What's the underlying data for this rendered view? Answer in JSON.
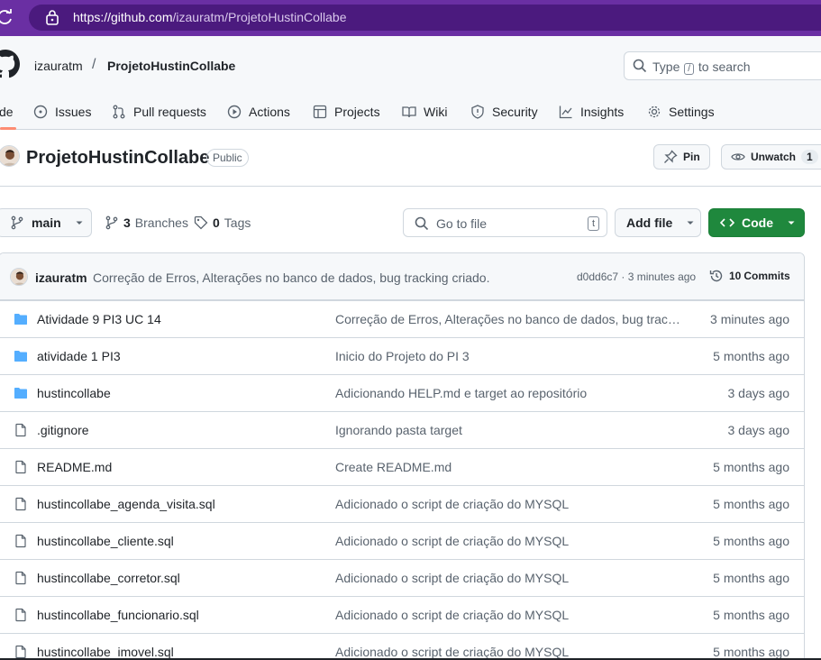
{
  "browser": {
    "url_host": "https://github.com",
    "url_path": "/izauratm/ProjetoHustinCollabe"
  },
  "header": {
    "owner": "izauratm",
    "separator": "/",
    "repo": "ProjetoHustinCollabe",
    "search_prefix": "Type",
    "search_key": "/",
    "search_suffix": "to search"
  },
  "tabs": [
    {
      "label": "de",
      "icon": "code-icon"
    },
    {
      "label": "Issues",
      "icon": "issue-icon"
    },
    {
      "label": "Pull requests",
      "icon": "pull-request-icon"
    },
    {
      "label": "Actions",
      "icon": "play-icon"
    },
    {
      "label": "Projects",
      "icon": "table-icon"
    },
    {
      "label": "Wiki",
      "icon": "book-icon"
    },
    {
      "label": "Security",
      "icon": "shield-icon"
    },
    {
      "label": "Insights",
      "icon": "graph-icon"
    },
    {
      "label": "Settings",
      "icon": "gear-icon"
    }
  ],
  "repo_title": {
    "name": "ProjetoHustinCollabe",
    "visibility": "Public",
    "pin_label": "Pin",
    "unwatch_label": "Unwatch",
    "watch_count": "1"
  },
  "branch_bar": {
    "branch": "main",
    "branches_count": "3",
    "branches_label": "Branches",
    "tags_count": "0",
    "tags_label": "Tags",
    "goto_placeholder": "Go to file",
    "goto_key": "t",
    "add_file": "Add file",
    "code": "Code"
  },
  "last_commit": {
    "author": "izauratm",
    "message": "Correção de Erros, Alterações no banco de dados, bug tracking criado.",
    "hash_time": "d0dd6c7 · 3 minutes ago",
    "commits_count": "10",
    "commits_label": "Commits"
  },
  "files": [
    {
      "type": "folder",
      "name": "Atividade 9 PI3 UC 14",
      "message": "Correção de Erros, Alterações no banco de dados, bug tracki...",
      "age": "3 minutes ago"
    },
    {
      "type": "folder",
      "name": "atividade 1 PI3",
      "message": "Inicio do Projeto do PI 3",
      "age": "5 months ago"
    },
    {
      "type": "folder",
      "name": "hustincollabe",
      "message": "Adicionando HELP.md e target ao repositório",
      "age": "3 days ago"
    },
    {
      "type": "file",
      "name": ".gitignore",
      "message": "Ignorando pasta target",
      "age": "3 days ago"
    },
    {
      "type": "file",
      "name": "README.md",
      "message": "Create README.md",
      "age": "5 months ago"
    },
    {
      "type": "file",
      "name": "hustincollabe_agenda_visita.sql",
      "message": "Adicionado o script de criação do MYSQL",
      "age": "5 months ago"
    },
    {
      "type": "file",
      "name": "hustincollabe_cliente.sql",
      "message": "Adicionado o script de criação do MYSQL",
      "age": "5 months ago"
    },
    {
      "type": "file",
      "name": "hustincollabe_corretor.sql",
      "message": "Adicionado o script de criação do MYSQL",
      "age": "5 months ago"
    },
    {
      "type": "file",
      "name": "hustincollabe_funcionario.sql",
      "message": "Adicionado o script de criação do MYSQL",
      "age": "5 months ago"
    },
    {
      "type": "file",
      "name": "hustincollabe_imovel.sql",
      "message": "Adicionado o script de criação do MYSQL",
      "age": "5 months ago"
    }
  ],
  "colors": {
    "browser_bar": "#6a2fa3",
    "primary_button": "#1f883d",
    "folder_icon": "#54aeff",
    "active_tab_underline": "#fd8c73"
  }
}
